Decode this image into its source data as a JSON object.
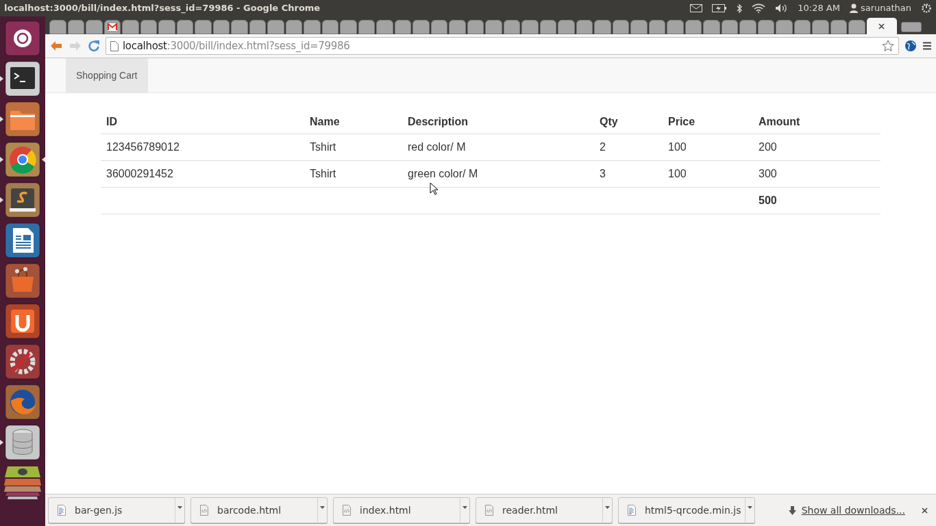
{
  "top_panel": {
    "title": "localhost:3000/bill/index.html?sess_id=79986 - Google Chrome",
    "clock": "10:28 AM",
    "user": "sarunathan"
  },
  "launcher": [
    {
      "kind": "home",
      "running": false,
      "focused": false
    },
    {
      "kind": "terminal",
      "running": true,
      "focused": false
    },
    {
      "kind": "folder",
      "running": true,
      "focused": false
    },
    {
      "kind": "chrome",
      "running": true,
      "focused": true
    },
    {
      "kind": "editor",
      "running": true,
      "focused": false
    },
    {
      "kind": "writer",
      "running": false,
      "focused": false
    },
    {
      "kind": "store",
      "running": false,
      "focused": false
    },
    {
      "kind": "cloud",
      "running": false,
      "focused": false
    },
    {
      "kind": "settings",
      "running": false,
      "focused": false
    },
    {
      "kind": "firefox",
      "running": false,
      "focused": false
    },
    {
      "kind": "database",
      "running": true,
      "focused": false
    }
  ],
  "tabs": [
    {
      "kind": "blank",
      "selected": false
    },
    {
      "kind": "blank",
      "selected": false
    },
    {
      "kind": "blank",
      "selected": false
    },
    {
      "kind": "mail",
      "selected": false
    },
    {
      "kind": "blank",
      "selected": false
    },
    {
      "kind": "blank",
      "selected": false
    },
    {
      "kind": "blank",
      "selected": false
    },
    {
      "kind": "blank",
      "selected": false
    },
    {
      "kind": "blank",
      "selected": false
    },
    {
      "kind": "blank",
      "selected": false
    },
    {
      "kind": "blank",
      "selected": false
    },
    {
      "kind": "blank",
      "selected": false
    },
    {
      "kind": "blank",
      "selected": false
    },
    {
      "kind": "blank",
      "selected": false
    },
    {
      "kind": "blank",
      "selected": false
    },
    {
      "kind": "blank",
      "selected": false
    },
    {
      "kind": "blank",
      "selected": false
    },
    {
      "kind": "blank",
      "selected": false
    },
    {
      "kind": "blank",
      "selected": false
    },
    {
      "kind": "blank",
      "selected": false
    },
    {
      "kind": "blank",
      "selected": false
    },
    {
      "kind": "blank",
      "selected": false
    },
    {
      "kind": "blank",
      "selected": false
    },
    {
      "kind": "blank",
      "selected": false
    },
    {
      "kind": "blank",
      "selected": false
    },
    {
      "kind": "blank",
      "selected": false
    },
    {
      "kind": "blank",
      "selected": false
    },
    {
      "kind": "blank",
      "selected": false
    },
    {
      "kind": "blank",
      "selected": false
    },
    {
      "kind": "blank",
      "selected": false
    },
    {
      "kind": "blank",
      "selected": false
    },
    {
      "kind": "blank",
      "selected": false
    },
    {
      "kind": "blank",
      "selected": false
    },
    {
      "kind": "blank",
      "selected": false
    },
    {
      "kind": "blank",
      "selected": false
    },
    {
      "kind": "blank",
      "selected": false
    },
    {
      "kind": "blank",
      "selected": false
    },
    {
      "kind": "blank",
      "selected": false
    },
    {
      "kind": "blank",
      "selected": false
    },
    {
      "kind": "blank",
      "selected": false
    },
    {
      "kind": "blank",
      "selected": false
    },
    {
      "kind": "blank",
      "selected": false
    },
    {
      "kind": "blank",
      "selected": false
    },
    {
      "kind": "blank",
      "selected": false
    },
    {
      "kind": "blank",
      "selected": false
    },
    {
      "kind": "blank",
      "selected": true
    }
  ],
  "address_bar": {
    "host": "localhost",
    "rest": ":3000/bill/index.html?sess_id=79986"
  },
  "navbar": {
    "items": [
      {
        "label": "Shopping Cart",
        "selected": true
      }
    ]
  },
  "table": {
    "columns": [
      "ID",
      "Name",
      "Description",
      "Qty",
      "Price",
      "Amount"
    ],
    "rows": [
      [
        "123456789012",
        "Tshirt",
        "red color/ M",
        "2",
        "100",
        "200"
      ],
      [
        "36000291452",
        "Tshirt",
        "green color/ M",
        "3",
        "100",
        "300"
      ]
    ],
    "total": "500"
  },
  "downloads": {
    "items": [
      {
        "name": "bar-gen.js",
        "kind": "script"
      },
      {
        "name": "barcode.html",
        "kind": "html"
      },
      {
        "name": "index.html",
        "kind": "html"
      },
      {
        "name": "reader.html",
        "kind": "html"
      },
      {
        "name": "html5-qrcode.min.js",
        "kind": "script"
      }
    ],
    "show_all": "Show all downloads..."
  }
}
